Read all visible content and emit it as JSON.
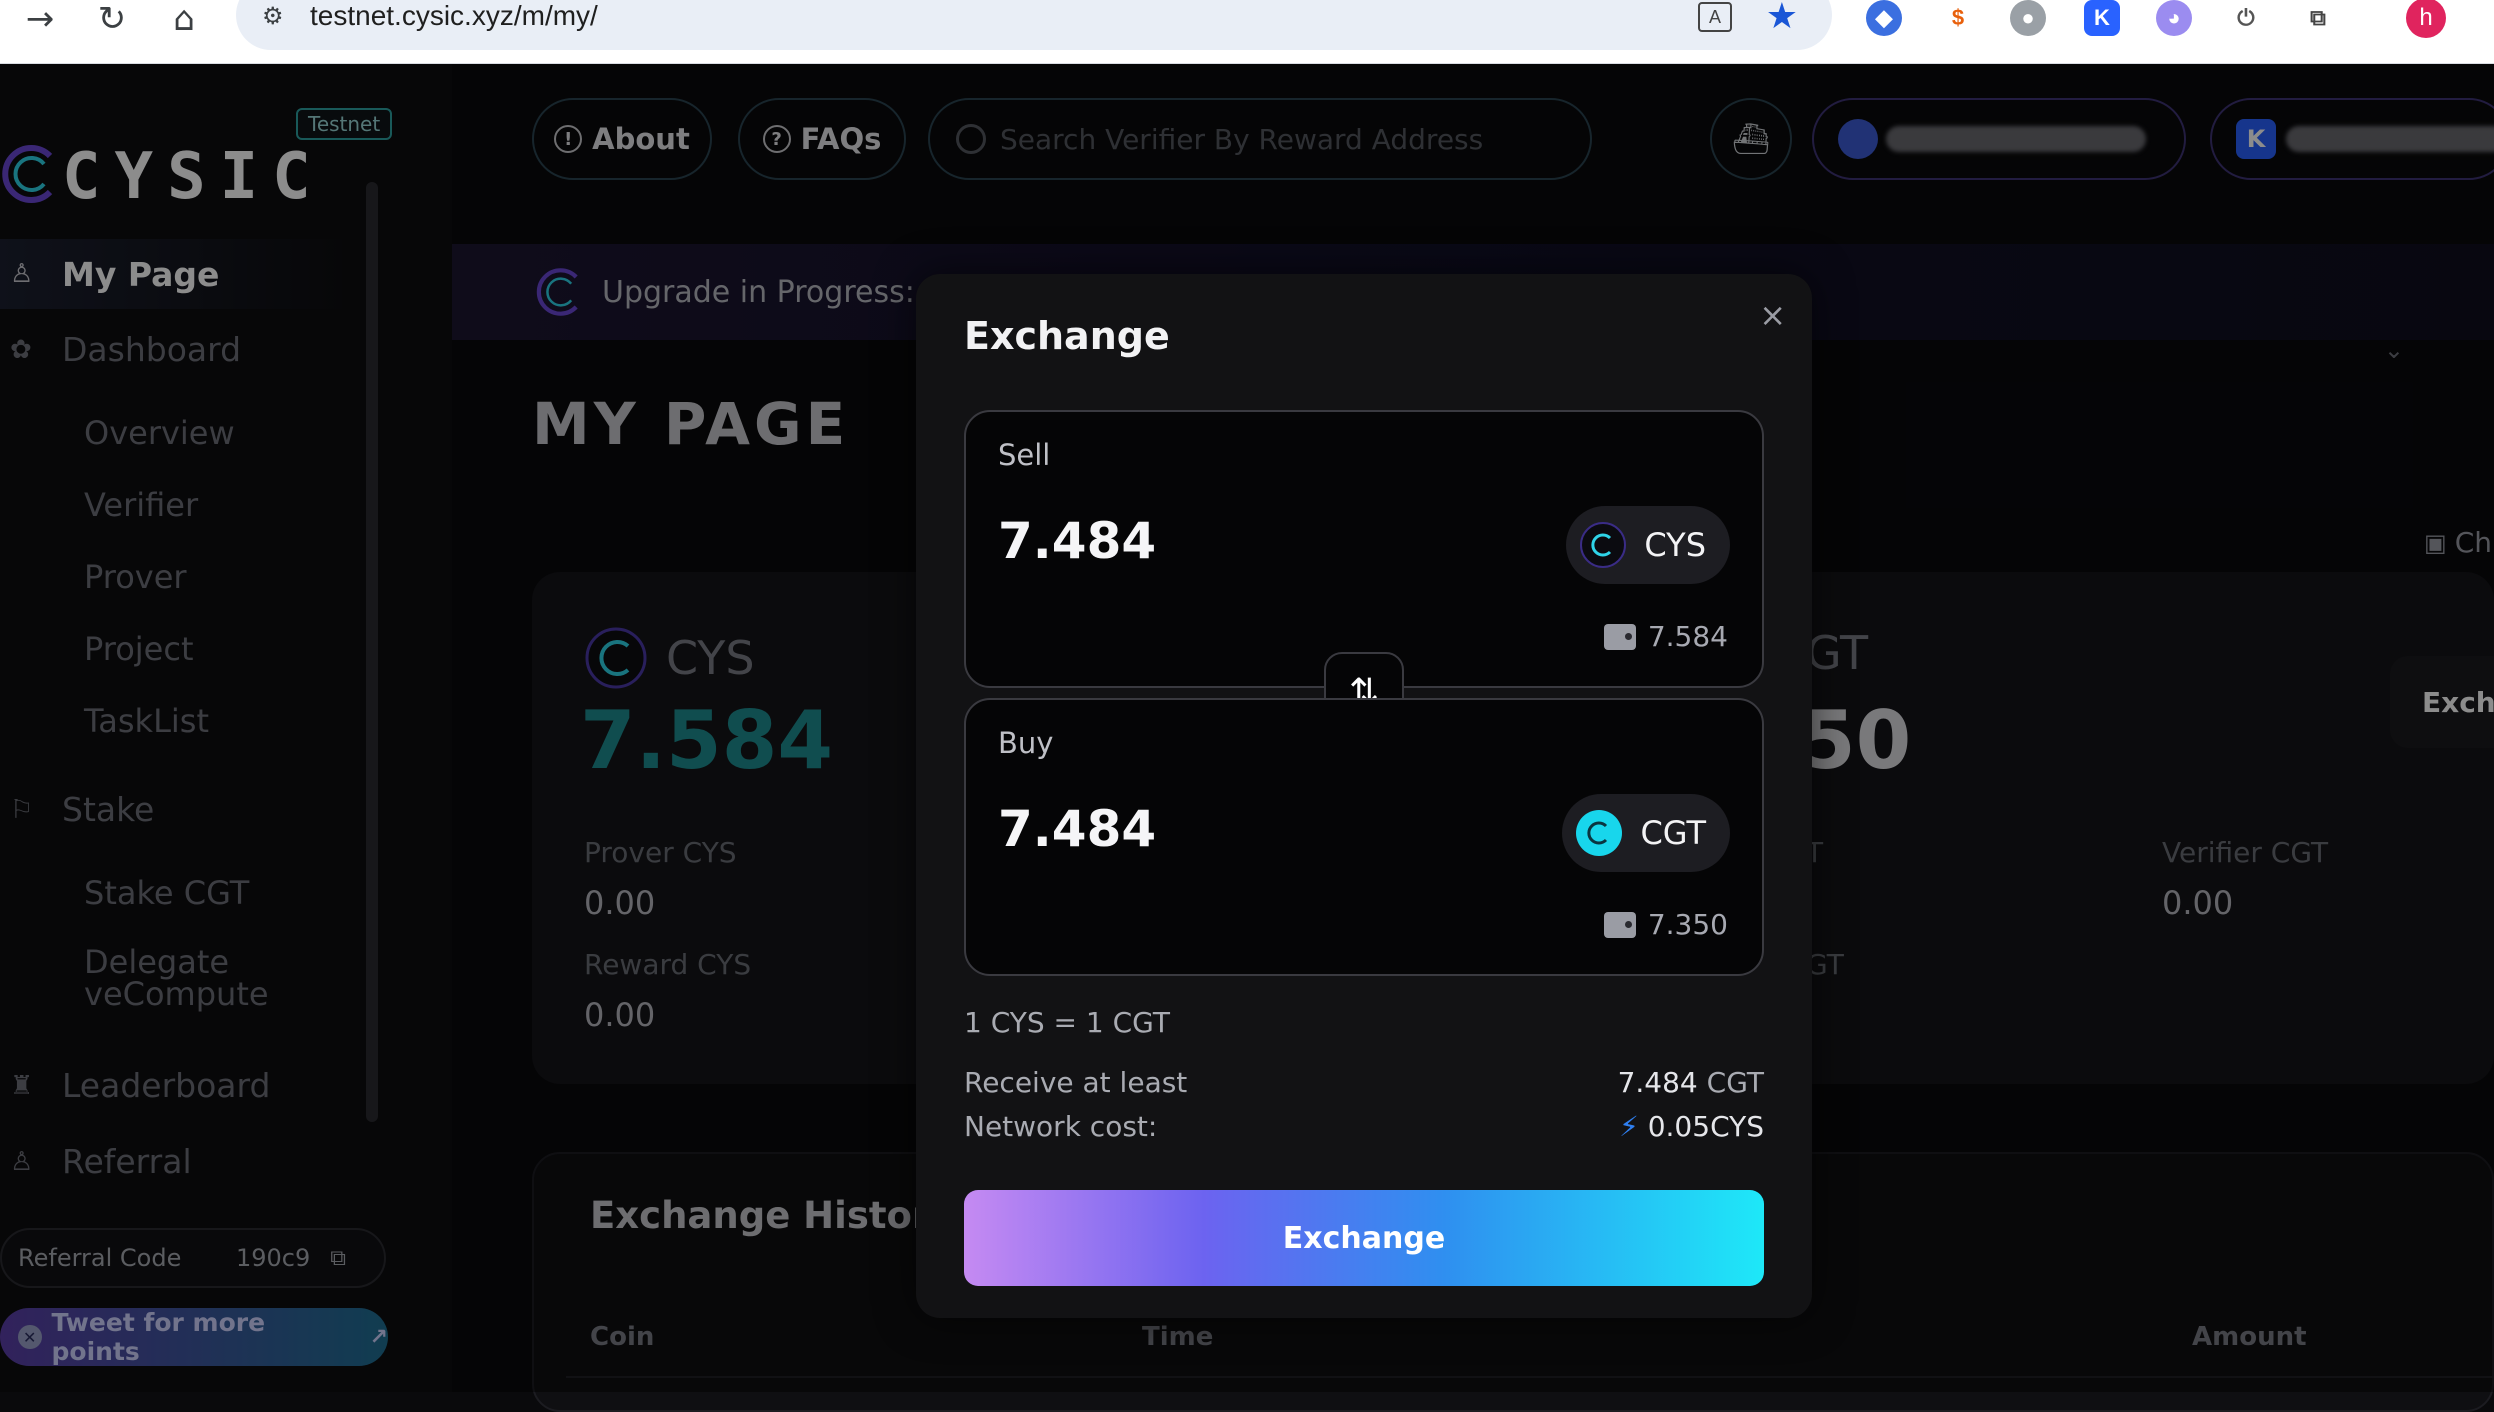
{
  "browser": {
    "url": "testnet.cysic.xyz/m/my/",
    "profile_initial": "h",
    "ext_k": "K"
  },
  "sidebar": {
    "logo_text": "CYSIC",
    "badge": "Testnet",
    "my_page": "My Page",
    "dashboard": "Dashboard",
    "dashboard_items": [
      "Overview",
      "Verifier",
      "Prover",
      "Project",
      "TaskList"
    ],
    "stake": "Stake",
    "stake_items": [
      "Stake CGT",
      "Delegate veCompute"
    ],
    "leaderboard": "Leaderboard",
    "referral": "Referral",
    "referral_code_label": "Referral Code",
    "referral_code_value": "190c9",
    "tweet_label": "Tweet for more points"
  },
  "header": {
    "about": "About",
    "faqs": "FAQs",
    "search_placeholder": "Search Verifier By Reward Address",
    "wallet_initial": "K"
  },
  "banner": {
    "text": "Upgrade in Progress: ve"
  },
  "page": {
    "title": "MY PAGE",
    "cys_card": {
      "token": "CYS",
      "balance": "7.584",
      "prover_label": "Prover CYS",
      "prover_value": "0.00",
      "reward_label": "Reward CYS",
      "reward_value": "0.00"
    },
    "cgt_card": {
      "token_partial": "GT",
      "balance_partial": "50",
      "label_partial_1": "T",
      "label_partial_2": "GT",
      "verifier_label": "Verifier CGT",
      "verifier_value": "0.00"
    },
    "right_stub": "Exch",
    "ch_link": "Ch",
    "history": {
      "title": "Exchange History",
      "columns": [
        "Coin",
        "Time",
        "Amount"
      ]
    }
  },
  "modal": {
    "title": "Exchange",
    "sell": {
      "label": "Sell",
      "amount": "7.484",
      "token": "CYS",
      "balance": "7.584"
    },
    "buy": {
      "label": "Buy",
      "amount": "7.484",
      "token": "CGT",
      "balance": "7.350"
    },
    "rate": "1 CYS = 1 CGT",
    "receive_label": "Receive at least",
    "receive_value": "7.484",
    "receive_unit": "CGT",
    "network_label": "Network cost:",
    "network_value": "0.05CYS",
    "button": "Exchange"
  },
  "colors": {
    "accent_teal": "#1e8c90",
    "cgt_coin": "#18d6ec",
    "border": "#2b4450"
  }
}
